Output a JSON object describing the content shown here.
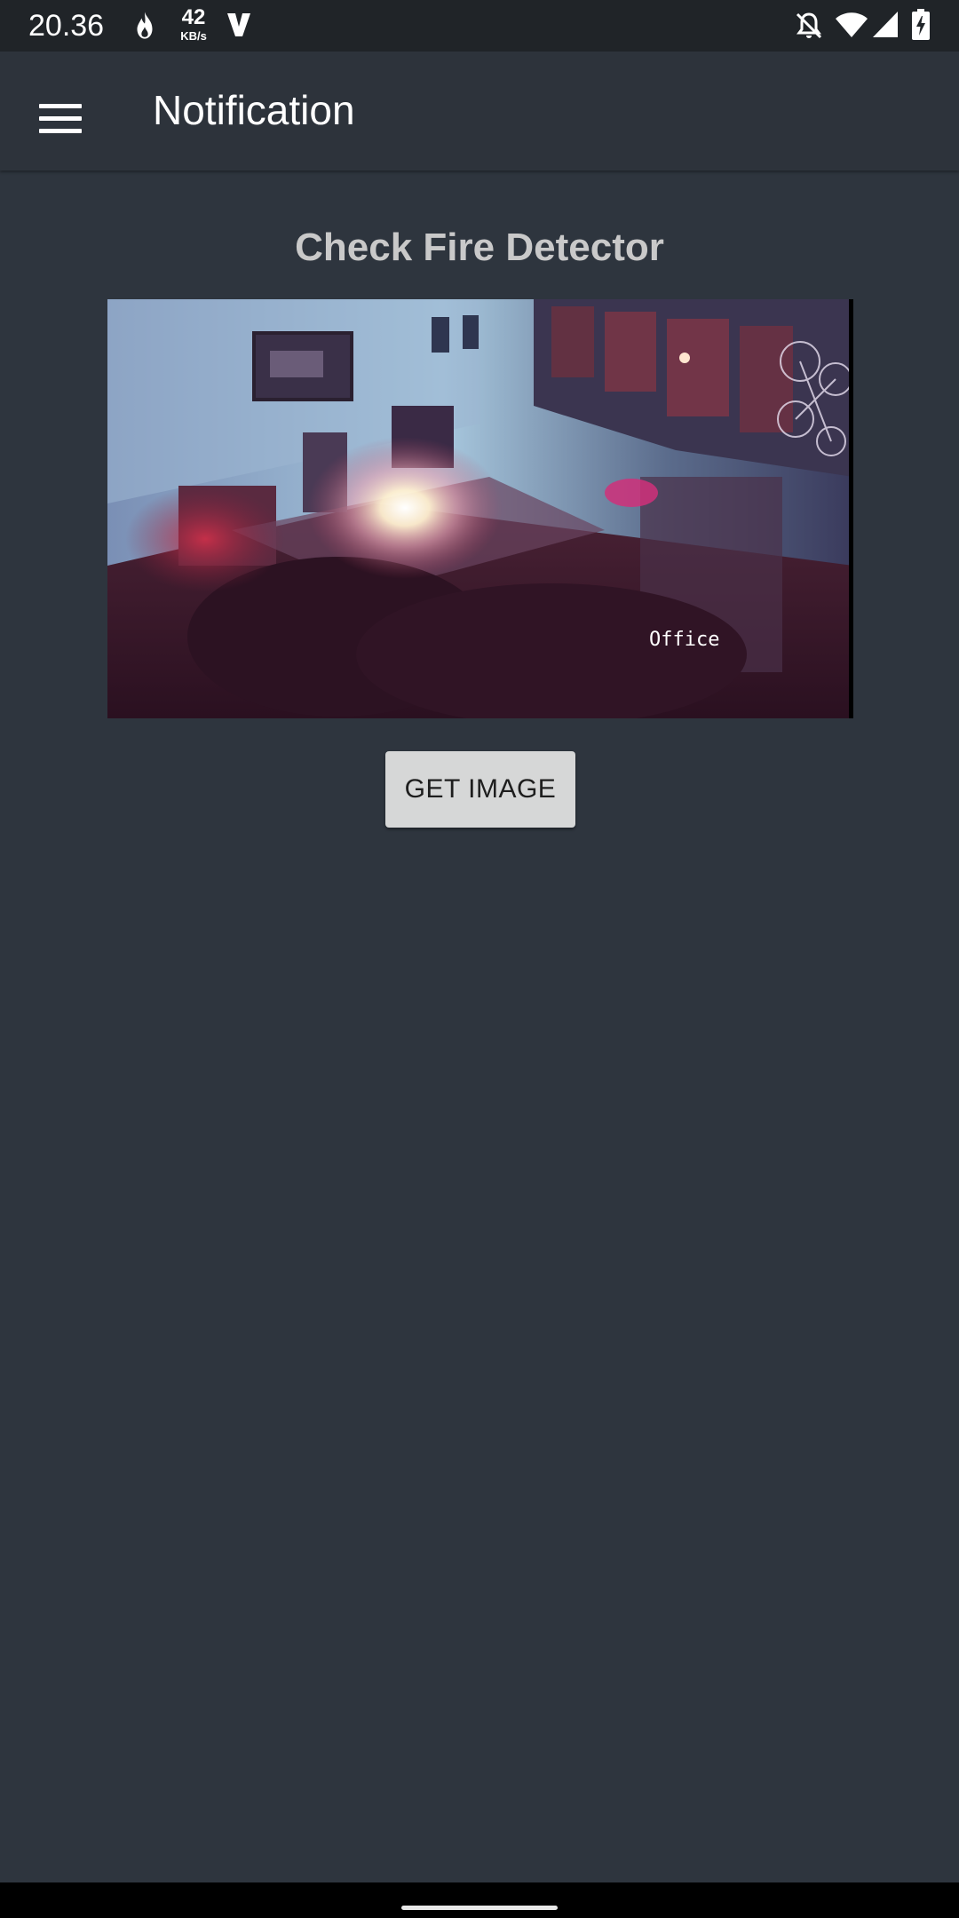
{
  "status_bar": {
    "time": "20.36",
    "speed_value": "42",
    "speed_unit": "KB/s",
    "icons": [
      "flame-icon",
      "v-icon",
      "bell-off-icon",
      "wifi-icon",
      "signal-icon",
      "battery-charging-icon"
    ]
  },
  "app_bar": {
    "title": "Notification",
    "menu_icon": "hamburger-menu-icon"
  },
  "content": {
    "heading": "Check Fire Detector",
    "camera_label": "Office",
    "button_label": "GET IMAGE"
  },
  "colors": {
    "background": "#2e353e",
    "app_bar": "#2d333b",
    "status_bar": "#202428",
    "heading_text": "#c9c9c9",
    "button_bg": "#d6d7d7"
  }
}
